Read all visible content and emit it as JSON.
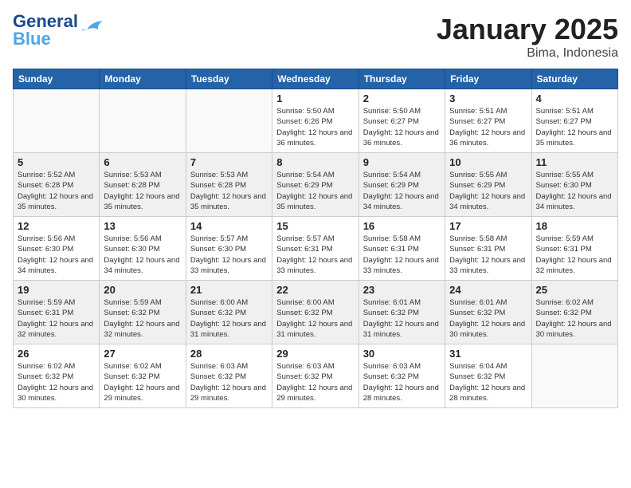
{
  "header": {
    "logo_line1": "General",
    "logo_line2": "Blue",
    "month": "January 2025",
    "location": "Bima, Indonesia"
  },
  "days_of_week": [
    "Sunday",
    "Monday",
    "Tuesday",
    "Wednesday",
    "Thursday",
    "Friday",
    "Saturday"
  ],
  "weeks": [
    {
      "shaded": false,
      "days": [
        {
          "num": "",
          "info": ""
        },
        {
          "num": "",
          "info": ""
        },
        {
          "num": "",
          "info": ""
        },
        {
          "num": "1",
          "info": "Sunrise: 5:50 AM\nSunset: 6:26 PM\nDaylight: 12 hours\nand 36 minutes."
        },
        {
          "num": "2",
          "info": "Sunrise: 5:50 AM\nSunset: 6:27 PM\nDaylight: 12 hours\nand 36 minutes."
        },
        {
          "num": "3",
          "info": "Sunrise: 5:51 AM\nSunset: 6:27 PM\nDaylight: 12 hours\nand 36 minutes."
        },
        {
          "num": "4",
          "info": "Sunrise: 5:51 AM\nSunset: 6:27 PM\nDaylight: 12 hours\nand 35 minutes."
        }
      ]
    },
    {
      "shaded": true,
      "days": [
        {
          "num": "5",
          "info": "Sunrise: 5:52 AM\nSunset: 6:28 PM\nDaylight: 12 hours\nand 35 minutes."
        },
        {
          "num": "6",
          "info": "Sunrise: 5:53 AM\nSunset: 6:28 PM\nDaylight: 12 hours\nand 35 minutes."
        },
        {
          "num": "7",
          "info": "Sunrise: 5:53 AM\nSunset: 6:28 PM\nDaylight: 12 hours\nand 35 minutes."
        },
        {
          "num": "8",
          "info": "Sunrise: 5:54 AM\nSunset: 6:29 PM\nDaylight: 12 hours\nand 35 minutes."
        },
        {
          "num": "9",
          "info": "Sunrise: 5:54 AM\nSunset: 6:29 PM\nDaylight: 12 hours\nand 34 minutes."
        },
        {
          "num": "10",
          "info": "Sunrise: 5:55 AM\nSunset: 6:29 PM\nDaylight: 12 hours\nand 34 minutes."
        },
        {
          "num": "11",
          "info": "Sunrise: 5:55 AM\nSunset: 6:30 PM\nDaylight: 12 hours\nand 34 minutes."
        }
      ]
    },
    {
      "shaded": false,
      "days": [
        {
          "num": "12",
          "info": "Sunrise: 5:56 AM\nSunset: 6:30 PM\nDaylight: 12 hours\nand 34 minutes."
        },
        {
          "num": "13",
          "info": "Sunrise: 5:56 AM\nSunset: 6:30 PM\nDaylight: 12 hours\nand 34 minutes."
        },
        {
          "num": "14",
          "info": "Sunrise: 5:57 AM\nSunset: 6:30 PM\nDaylight: 12 hours\nand 33 minutes."
        },
        {
          "num": "15",
          "info": "Sunrise: 5:57 AM\nSunset: 6:31 PM\nDaylight: 12 hours\nand 33 minutes."
        },
        {
          "num": "16",
          "info": "Sunrise: 5:58 AM\nSunset: 6:31 PM\nDaylight: 12 hours\nand 33 minutes."
        },
        {
          "num": "17",
          "info": "Sunrise: 5:58 AM\nSunset: 6:31 PM\nDaylight: 12 hours\nand 33 minutes."
        },
        {
          "num": "18",
          "info": "Sunrise: 5:59 AM\nSunset: 6:31 PM\nDaylight: 12 hours\nand 32 minutes."
        }
      ]
    },
    {
      "shaded": true,
      "days": [
        {
          "num": "19",
          "info": "Sunrise: 5:59 AM\nSunset: 6:31 PM\nDaylight: 12 hours\nand 32 minutes."
        },
        {
          "num": "20",
          "info": "Sunrise: 5:59 AM\nSunset: 6:32 PM\nDaylight: 12 hours\nand 32 minutes."
        },
        {
          "num": "21",
          "info": "Sunrise: 6:00 AM\nSunset: 6:32 PM\nDaylight: 12 hours\nand 31 minutes."
        },
        {
          "num": "22",
          "info": "Sunrise: 6:00 AM\nSunset: 6:32 PM\nDaylight: 12 hours\nand 31 minutes."
        },
        {
          "num": "23",
          "info": "Sunrise: 6:01 AM\nSunset: 6:32 PM\nDaylight: 12 hours\nand 31 minutes."
        },
        {
          "num": "24",
          "info": "Sunrise: 6:01 AM\nSunset: 6:32 PM\nDaylight: 12 hours\nand 30 minutes."
        },
        {
          "num": "25",
          "info": "Sunrise: 6:02 AM\nSunset: 6:32 PM\nDaylight: 12 hours\nand 30 minutes."
        }
      ]
    },
    {
      "shaded": false,
      "days": [
        {
          "num": "26",
          "info": "Sunrise: 6:02 AM\nSunset: 6:32 PM\nDaylight: 12 hours\nand 30 minutes."
        },
        {
          "num": "27",
          "info": "Sunrise: 6:02 AM\nSunset: 6:32 PM\nDaylight: 12 hours\nand 29 minutes."
        },
        {
          "num": "28",
          "info": "Sunrise: 6:03 AM\nSunset: 6:32 PM\nDaylight: 12 hours\nand 29 minutes."
        },
        {
          "num": "29",
          "info": "Sunrise: 6:03 AM\nSunset: 6:32 PM\nDaylight: 12 hours\nand 29 minutes."
        },
        {
          "num": "30",
          "info": "Sunrise: 6:03 AM\nSunset: 6:32 PM\nDaylight: 12 hours\nand 28 minutes."
        },
        {
          "num": "31",
          "info": "Sunrise: 6:04 AM\nSunset: 6:32 PM\nDaylight: 12 hours\nand 28 minutes."
        },
        {
          "num": "",
          "info": ""
        }
      ]
    }
  ]
}
